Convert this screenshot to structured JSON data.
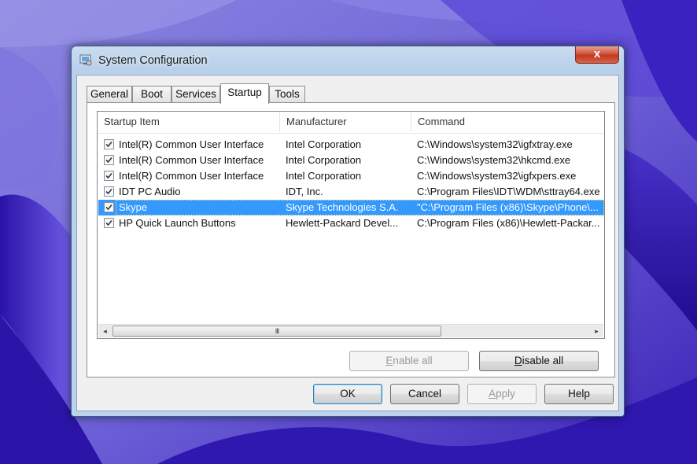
{
  "window": {
    "title": "System Configuration",
    "close_glyph": "x"
  },
  "tabs": [
    {
      "label": "General",
      "active": false
    },
    {
      "label": "Boot",
      "active": false
    },
    {
      "label": "Services",
      "active": false
    },
    {
      "label": "Startup",
      "active": true
    },
    {
      "label": "Tools",
      "active": false
    }
  ],
  "table": {
    "columns": [
      "Startup Item",
      "Manufacturer",
      "Command"
    ],
    "rows": [
      {
        "checked": true,
        "item": "Intel(R) Common User Interface",
        "manufacturer": "Intel Corporation",
        "command": "C:\\Windows\\system32\\igfxtray.exe",
        "selected": false
      },
      {
        "checked": true,
        "item": "Intel(R) Common User Interface",
        "manufacturer": "Intel Corporation",
        "command": "C:\\Windows\\system32\\hkcmd.exe",
        "selected": false
      },
      {
        "checked": true,
        "item": "Intel(R) Common User Interface",
        "manufacturer": "Intel Corporation",
        "command": "C:\\Windows\\system32\\igfxpers.exe",
        "selected": false
      },
      {
        "checked": true,
        "item": "IDT PC Audio",
        "manufacturer": "IDT, Inc.",
        "command": "C:\\Program Files\\IDT\\WDM\\sttray64.exe",
        "selected": false
      },
      {
        "checked": true,
        "item": "Skype",
        "manufacturer": "Skype Technologies S.A.",
        "command": "\"C:\\Program Files (x86)\\Skype\\Phone\\...",
        "selected": true
      },
      {
        "checked": true,
        "item": "HP Quick Launch Buttons",
        "manufacturer": "Hewlett-Packard Devel...",
        "command": "C:\\Program Files (x86)\\Hewlett-Packar..."
      }
    ],
    "scroll_left_glyph": "◂",
    "scroll_right_glyph": "▸",
    "thumb_grip": "III"
  },
  "panel_buttons": {
    "enable_all": {
      "accel": "E",
      "rest": "nable all",
      "enabled": false
    },
    "disable_all": {
      "accel": "D",
      "rest": "isable all",
      "enabled": true
    }
  },
  "dialog_buttons": {
    "ok": "OK",
    "cancel": "Cancel",
    "apply": {
      "accel": "A",
      "rest": "pply",
      "enabled": false
    },
    "help": "Help"
  },
  "colors": {
    "selection": "#3399ff",
    "wallpaper": "#6b5fd6"
  }
}
